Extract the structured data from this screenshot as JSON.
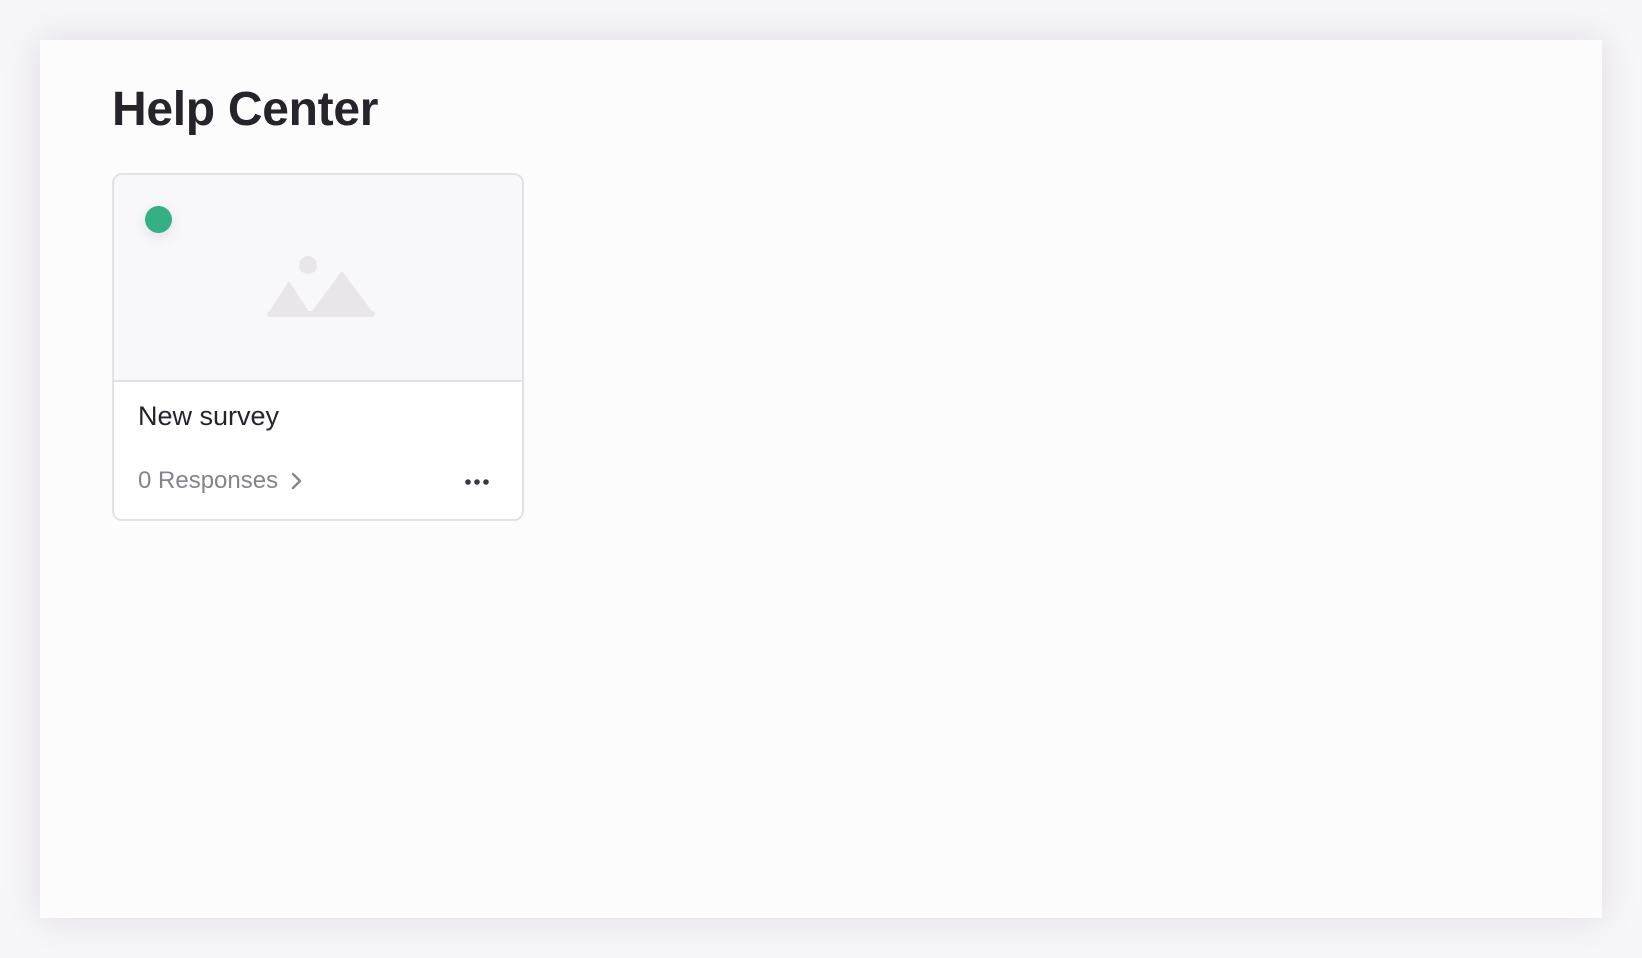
{
  "page": {
    "title": "Help Center"
  },
  "survey_card": {
    "title": "New survey",
    "responses_label": "0 Responses",
    "status": "active",
    "status_color": "#34b084",
    "thumbnail_icon": "image-placeholder-icon",
    "chevron_icon": "chevron-right-icon",
    "menu_icon": "more-horizontal-icon"
  },
  "colors": {
    "text_primary": "#26232b",
    "text_secondary": "#86838b",
    "border": "#e3e1e5",
    "thumbnail_bg": "#f8f7f9",
    "placeholder_icon": "#e8e6ea"
  }
}
